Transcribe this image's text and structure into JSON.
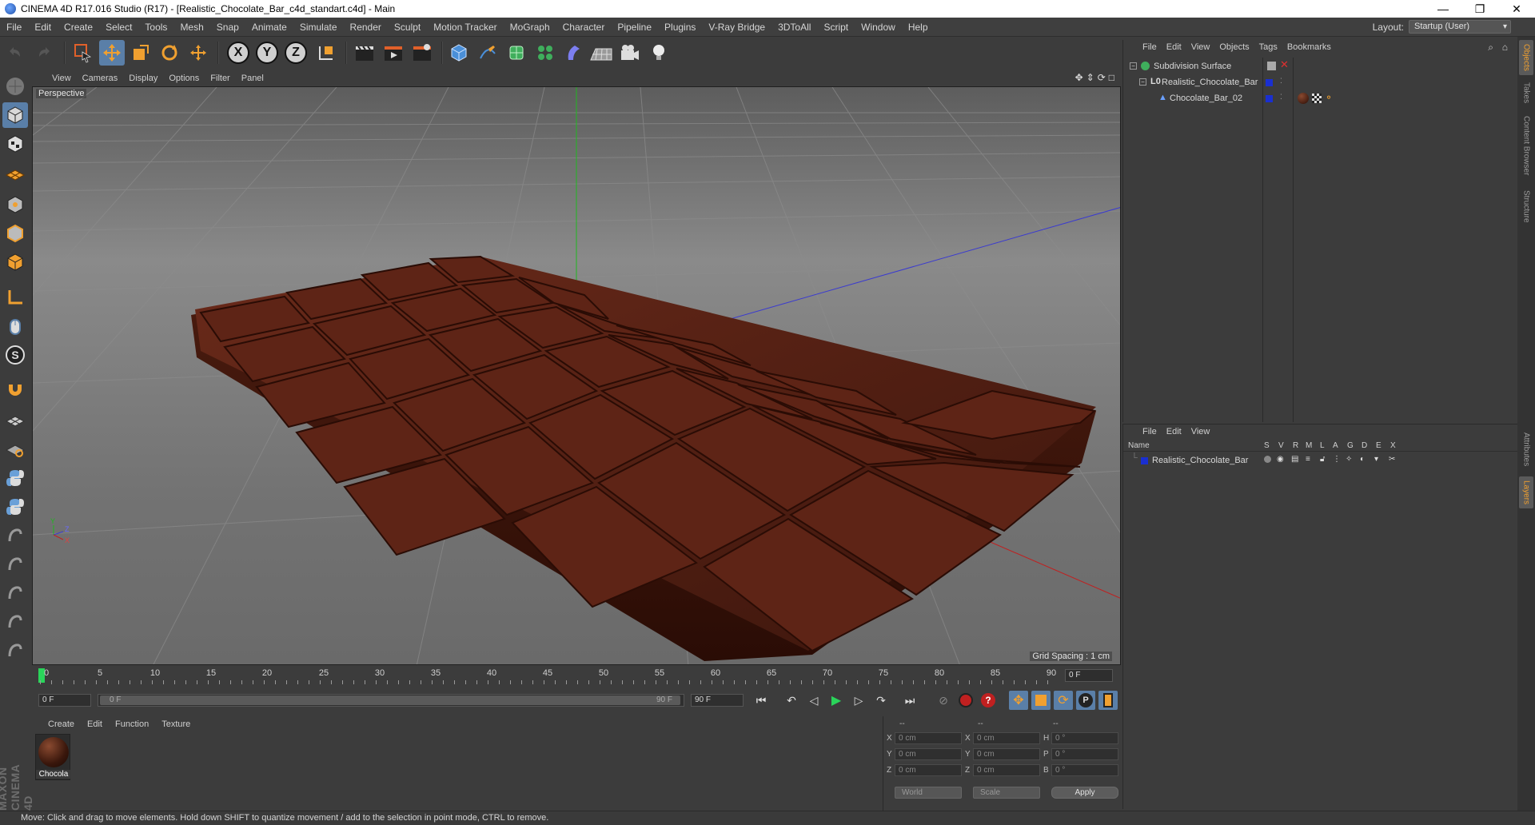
{
  "window": {
    "title": "CINEMA 4D R17.016 Studio (R17) - [Realistic_Chocolate_Bar_c4d_standart.c4d] - Main",
    "minimize": "—",
    "maximize": "❐",
    "close": "✕"
  },
  "menu": [
    "File",
    "Edit",
    "Create",
    "Select",
    "Tools",
    "Mesh",
    "Snap",
    "Animate",
    "Simulate",
    "Render",
    "Sculpt",
    "Motion Tracker",
    "MoGraph",
    "Character",
    "Pipeline",
    "Plugins",
    "V-Ray Bridge",
    "3DToAll",
    "Script",
    "Window",
    "Help"
  ],
  "layout": {
    "label": "Layout:",
    "value": "Startup (User)"
  },
  "toolbar": {
    "axis_x": "X",
    "axis_y": "Y",
    "axis_z": "Z"
  },
  "viewport": {
    "menu": [
      "View",
      "Cameras",
      "Display",
      "Options",
      "Filter",
      "Panel"
    ],
    "camera_label": "Perspective",
    "grid_spacing": "Grid Spacing : 1 cm",
    "axis_y": "Y",
    "axis_z": "Z",
    "axis_x": "X"
  },
  "timeline": {
    "ticks": [
      "0",
      "5",
      "10",
      "15",
      "20",
      "25",
      "30",
      "35",
      "40",
      "45",
      "50",
      "55",
      "60",
      "65",
      "70",
      "75",
      "80",
      "85",
      "90"
    ],
    "current_frame": "0 F"
  },
  "transport": {
    "start_field": "0 F",
    "range_start": "0 F",
    "range_end": "90 F",
    "end_field": "90 F"
  },
  "material_manager": {
    "menu": [
      "Create",
      "Edit",
      "Function",
      "Texture"
    ],
    "material_name": "Chocola",
    "logo_text": "MAXON CINEMA 4D"
  },
  "coordinates": {
    "header": [
      "--",
      "--",
      "--"
    ],
    "rows": [
      {
        "axis": "X",
        "pos": "0 cm",
        "axis2": "X",
        "size": "0 cm",
        "rot_label": "H",
        "rot": "0 °"
      },
      {
        "axis": "Y",
        "pos": "0 cm",
        "axis2": "Y",
        "size": "0 cm",
        "rot_label": "P",
        "rot": "0 °"
      },
      {
        "axis": "Z",
        "pos": "0 cm",
        "axis2": "Z",
        "size": "0 cm",
        "rot_label": "B",
        "rot": "0 °"
      }
    ],
    "mode": "World",
    "scale_mode": "Scale",
    "apply": "Apply"
  },
  "status": "Move: Click and drag to move elements. Hold down SHIFT to quantize movement / add to the selection in point mode, CTRL to remove.",
  "object_manager": {
    "menu": [
      "File",
      "Edit",
      "View",
      "Objects",
      "Tags",
      "Bookmarks"
    ],
    "objects": [
      {
        "name": "Subdivision Surface",
        "indent": 0
      },
      {
        "name": "Realistic_Chocolate_Bar",
        "indent": 1
      },
      {
        "name": "Chocolate_Bar_02",
        "indent": 2
      }
    ]
  },
  "layer_manager": {
    "menu": [
      "File",
      "Edit",
      "View"
    ],
    "columns": [
      "Name",
      "S",
      "V",
      "R",
      "M",
      "L",
      "A",
      "G",
      "D",
      "E",
      "X"
    ],
    "layers": [
      {
        "name": "Realistic_Chocolate_Bar"
      }
    ]
  },
  "side_tabs": [
    "Objects",
    "Takes",
    "Content Browser",
    "Structure",
    "Attributes",
    "Layers"
  ],
  "colors": {
    "accent": "#f0a030",
    "chocolate_dark": "#3b150c",
    "chocolate_mid": "#5a2416",
    "layer_blue": "#1a2fd0"
  }
}
